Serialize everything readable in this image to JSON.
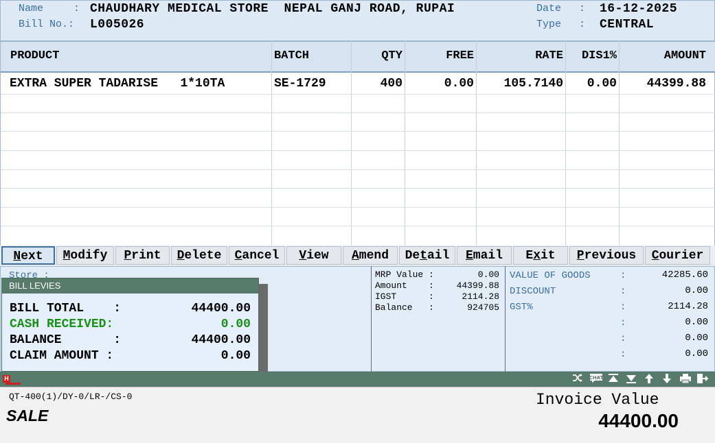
{
  "header": {
    "name_label": "Name",
    "name_value": "CHAUDHARY MEDICAL STORE  NEPAL GANJ ROAD, RUPAI",
    "bill_label": "Bill No.:",
    "bill_value": "L005026",
    "date_label": "Date",
    "date_value": "16-12-2025",
    "type_label": "Type",
    "type_value": "CENTRAL",
    "colon": ":"
  },
  "table": {
    "columns": [
      "PRODUCT",
      "BATCH",
      "QTY",
      "FREE",
      "RATE",
      "DIS1%",
      "AMOUNT"
    ],
    "rows": [
      {
        "product": "EXTRA SUPER TADARISE   1*10TA",
        "batch": "SE-1729",
        "qty": "400",
        "free": "0.00",
        "rate": "105.7140",
        "dis": "0.00",
        "amount": "44399.88"
      }
    ]
  },
  "buttons": [
    {
      "pre": "",
      "key": "N",
      "post": "ext"
    },
    {
      "pre": "",
      "key": "M",
      "post": "odify"
    },
    {
      "pre": "",
      "key": "P",
      "post": "rint"
    },
    {
      "pre": "",
      "key": "D",
      "post": "elete"
    },
    {
      "pre": "",
      "key": "C",
      "post": "ancel"
    },
    {
      "pre": "",
      "key": "V",
      "post": "iew"
    },
    {
      "pre": "",
      "key": "A",
      "post": "mend"
    },
    {
      "pre": "De",
      "key": "t",
      "post": "ail"
    },
    {
      "pre": "",
      "key": "E",
      "post": "mail"
    },
    {
      "pre": "E",
      "key": "x",
      "post": "it"
    },
    {
      "pre": "",
      "key": "P",
      "post": "revious"
    },
    {
      "pre": "",
      "key": "C",
      "post": "ourier"
    }
  ],
  "store_label": "Store :",
  "levies": {
    "title": "BILL LEVIES",
    "bill_total_label": "BILL TOTAL    :",
    "bill_total": "44400.00",
    "cash_label": "CASH RECEIVED:",
    "cash": "0.00",
    "balance_label": "BALANCE       :",
    "balance": "44400.00",
    "claim_label": "CLAIM AMOUNT :",
    "claim": "0.00"
  },
  "mid_info": [
    {
      "label": "MRP Value :",
      "value": "0.00"
    },
    {
      "label": "Amount    :",
      "value": "44399.88"
    },
    {
      "label": "IGST      :",
      "value": "2114.28"
    },
    {
      "label": "Balance   :",
      "value": "924705"
    }
  ],
  "right_info": [
    {
      "label": "VALUE OF GOODS",
      "value": "42285.60"
    },
    {
      "label": "DISCOUNT",
      "value": "0.00"
    },
    {
      "label": "GST%",
      "value": "2114.28"
    },
    {
      "label": "",
      "value": "0.00"
    },
    {
      "label": "",
      "value": "0.00"
    },
    {
      "label": "",
      "value": "0.00"
    }
  ],
  "status_icons": [
    "shuffle-icon",
    "chat-icon",
    "arrow-top-icon",
    "arrow-bottom-icon",
    "arrow-up-icon",
    "arrow-down-icon",
    "printer-icon",
    "exit-icon"
  ],
  "status_letter": "H",
  "footer": {
    "code": "QT-400(1)/DY-0/LR-/CS-0",
    "mode": "SALE",
    "invoice_label": "Invoice Value",
    "invoice_value": "44400.00"
  },
  "colors": {
    "accent": "#3a6e9c",
    "panel": "#587a6d",
    "cash": "#1a8f1a"
  }
}
